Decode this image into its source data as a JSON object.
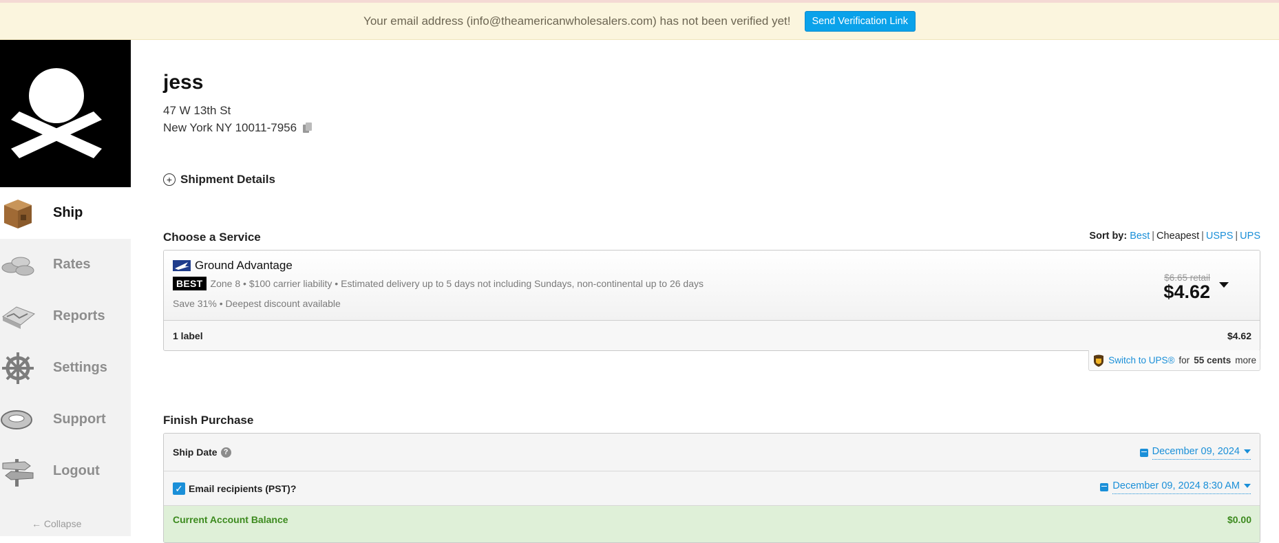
{
  "banner": {
    "message": "Your email address (info@theamericanwholesalers.com) has not been verified yet!",
    "button_label": "Send Verification Link"
  },
  "sidebar": {
    "items": [
      {
        "label": "Ship",
        "icon": "box-icon",
        "active": true
      },
      {
        "label": "Rates",
        "icon": "coins-icon"
      },
      {
        "label": "Reports",
        "icon": "map-icon"
      },
      {
        "label": "Settings",
        "icon": "ship-wheel-icon"
      },
      {
        "label": "Support",
        "icon": "life-ring-icon"
      },
      {
        "label": "Logout",
        "icon": "signpost-icon"
      }
    ],
    "collapse_label": "← Collapse"
  },
  "recipient": {
    "name": "jess",
    "address_line1": "47 W 13th St",
    "address_line2": "New York NY 10011-7956"
  },
  "shipment_details_label": "Shipment Details",
  "service_section": {
    "title": "Choose a Service",
    "sort_label": "Sort by:",
    "sort_options": [
      "Best",
      "Cheapest",
      "USPS",
      "UPS"
    ],
    "service": {
      "name": "Ground Advantage",
      "badge": "BEST",
      "details": "Zone 8 • $100 carrier liability • Estimated delivery up to 5 days not including Sundays, non-continental up to 26 days",
      "savings": "Save 31% • Deepest discount available",
      "retail_price": "$6.65 retail",
      "price": "$4.62"
    },
    "label_count": "1 label",
    "label_total": "$4.62",
    "ups_switch": {
      "link": "Switch to UPS®",
      "for": "for",
      "amount": "55 cents",
      "more": "more"
    }
  },
  "finish_section": {
    "title": "Finish Purchase",
    "ship_date_label": "Ship Date",
    "ship_date_value": "December 09, 2024",
    "email_label": "Email recipients (PST)?",
    "email_checked": true,
    "email_date_value": "December 09, 2024 8:30 AM",
    "balance_label": "Current Account Balance",
    "balance_value": "$0.00"
  },
  "colors": {
    "accent": "#1a8fd8",
    "verify_button": "#0aa2ea",
    "banner_bg": "#fbf5de",
    "balance_green": "#3c8a1e"
  }
}
